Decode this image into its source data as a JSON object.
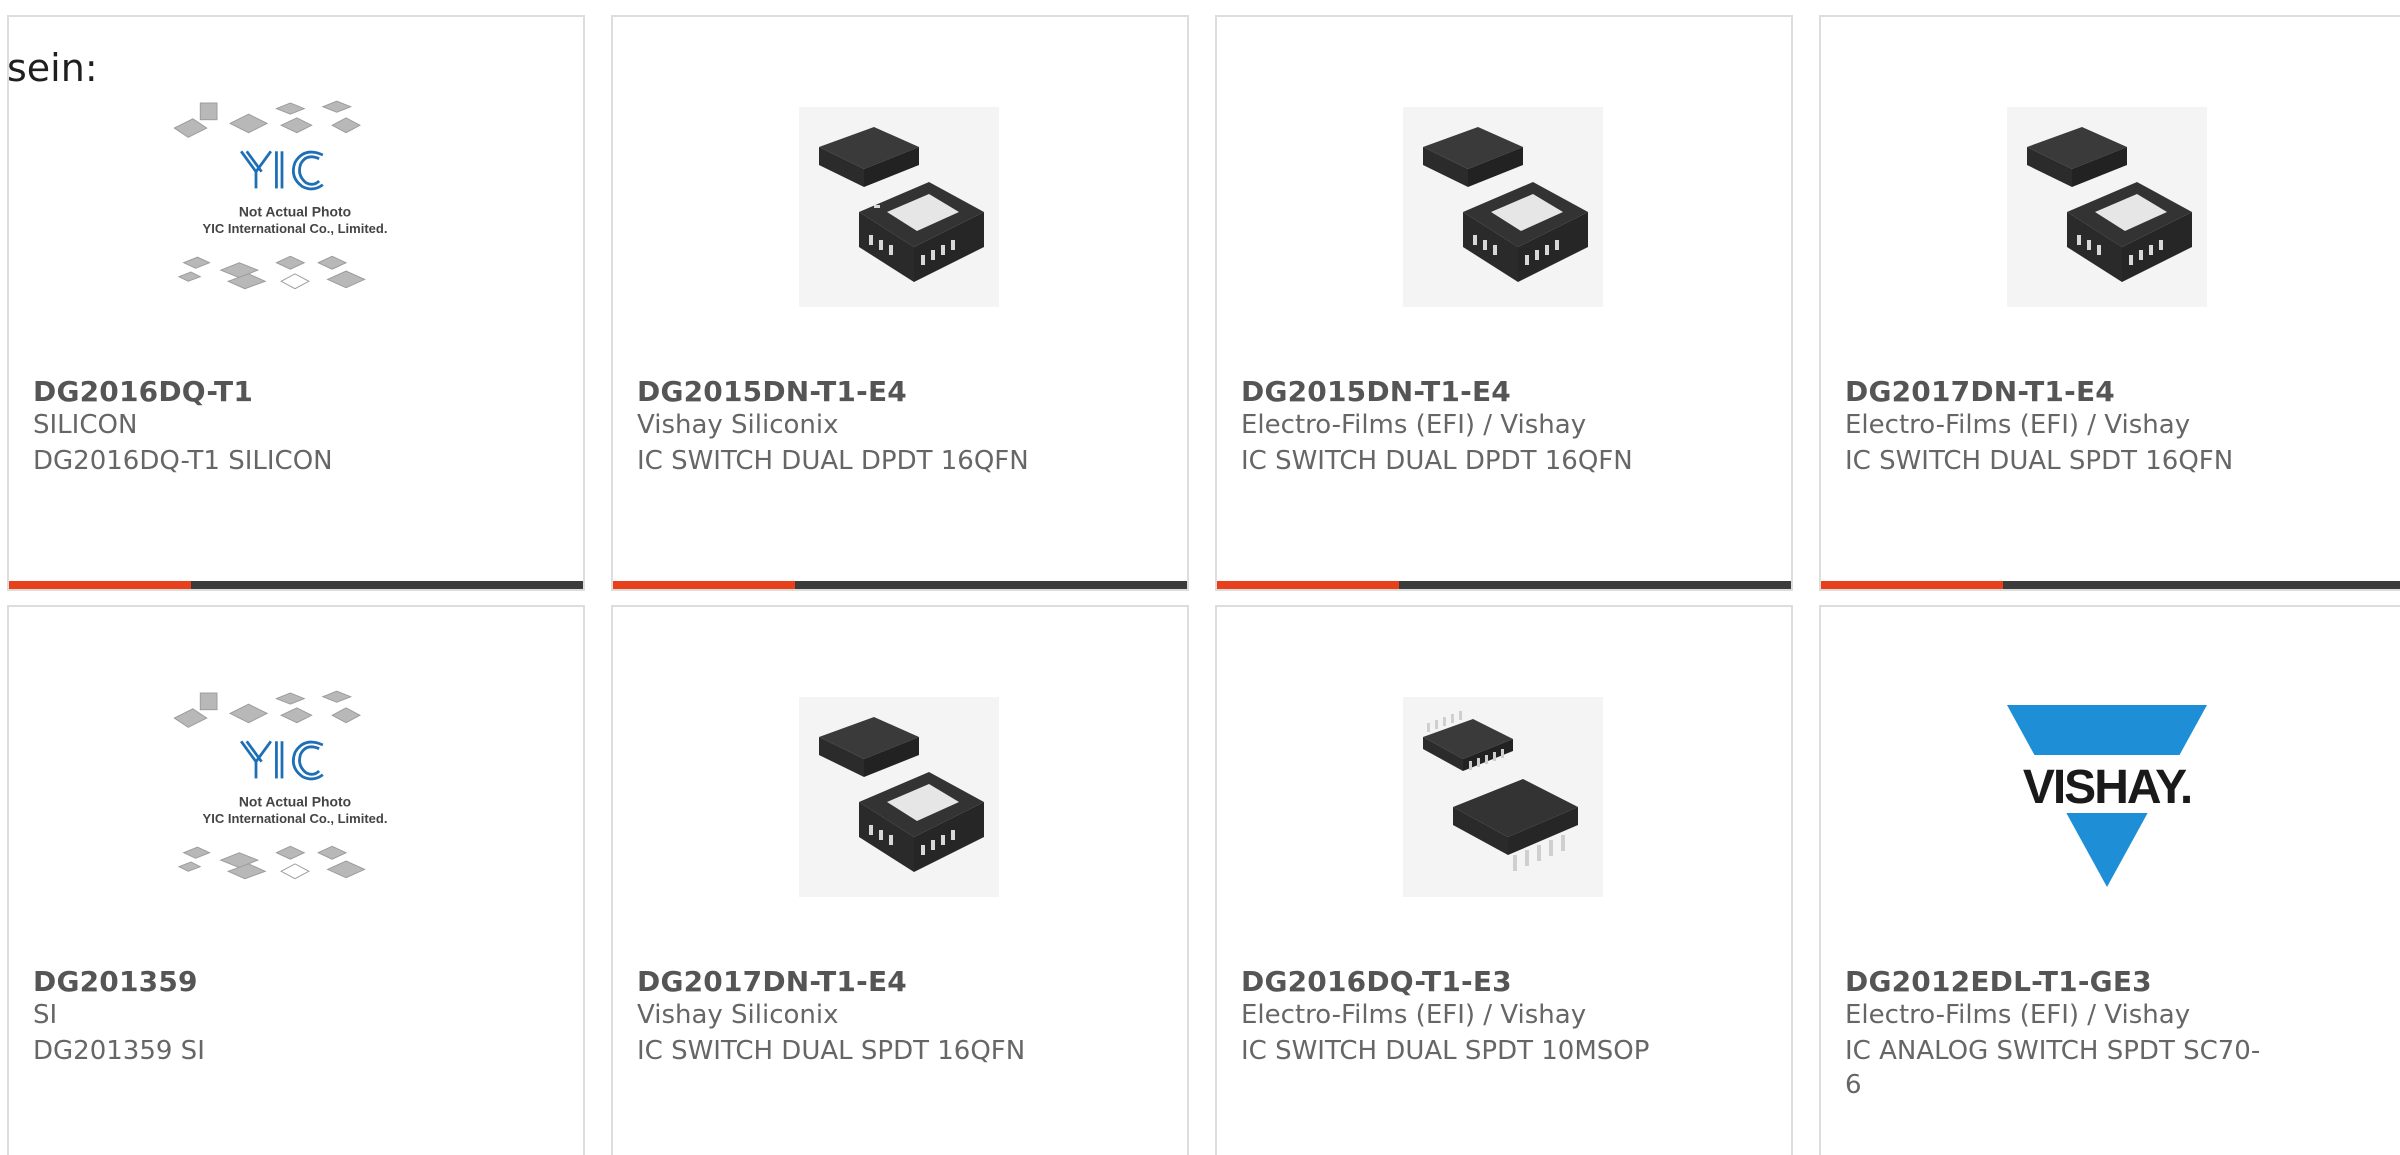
{
  "heading": "sein:",
  "colors": {
    "accent_bar": "#e8401b",
    "bar": "#3b3b3b",
    "border": "#dddddd",
    "text": "#666666",
    "vishay_blue": "#1e8fd6"
  },
  "products": [
    {
      "part_number": "DG2016DQ-T1",
      "manufacturer": "SILICON",
      "description": "DG2016DQ-T1 SILICON",
      "image": "yic-placeholder",
      "placeholder_line1": "Not Actual Photo",
      "placeholder_line2": "YIC International Co., Limited.",
      "placeholder_logo": "YIC"
    },
    {
      "part_number": "DG2015DN-T1-E4",
      "manufacturer": "Vishay Siliconix",
      "description": "IC SWITCH DUAL DPDT 16QFN",
      "image": "qfn-chip"
    },
    {
      "part_number": "DG2015DN-T1-E4",
      "manufacturer": "Electro-Films (EFI) / Vishay",
      "description": "IC SWITCH DUAL DPDT 16QFN",
      "image": "qfn-chip"
    },
    {
      "part_number": "DG2017DN-T1-E4",
      "manufacturer": "Electro-Films (EFI) / Vishay",
      "description": "IC SWITCH DUAL SPDT 16QFN",
      "image": "qfn-chip"
    },
    {
      "part_number": "DG201359",
      "manufacturer": "SI",
      "description": "DG201359 SI",
      "image": "yic-placeholder",
      "placeholder_line1": "Not Actual Photo",
      "placeholder_line2": "YIC International Co., Limited.",
      "placeholder_logo": "YIC"
    },
    {
      "part_number": "DG2017DN-T1-E4",
      "manufacturer": "Vishay Siliconix",
      "description": "IC SWITCH DUAL SPDT 16QFN",
      "image": "qfn-chip"
    },
    {
      "part_number": "DG2016DQ-T1-E3",
      "manufacturer": "Electro-Films (EFI) / Vishay",
      "description": "IC SWITCH DUAL SPDT 10MSOP",
      "image": "msop-chip"
    },
    {
      "part_number": "DG2012EDL-T1-GE3",
      "manufacturer": "Electro-Films (EFI) / Vishay",
      "description": "IC ANALOG SWITCH SPDT SC70-6",
      "image": "vishay-logo",
      "logo_text": "VISHAY."
    }
  ]
}
